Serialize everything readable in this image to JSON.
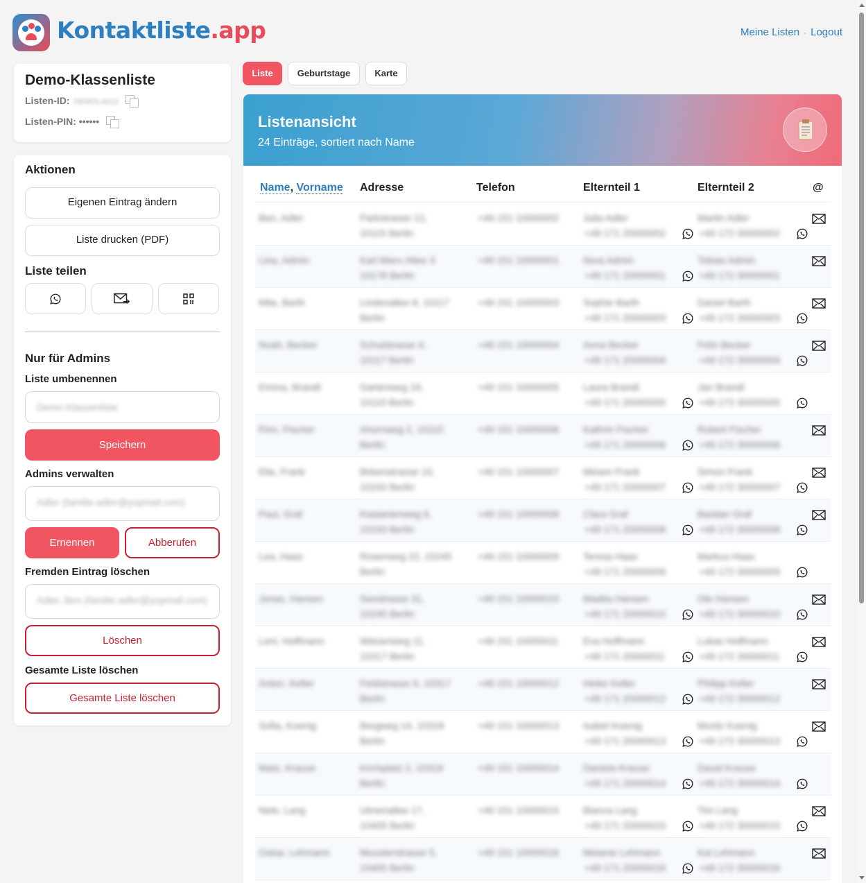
{
  "app": {
    "brand_part1": "Kontaktliste",
    "brand_part2": ".app",
    "nav_my_lists": "Meine Listen",
    "nav_sep": "·",
    "nav_logout": "Logout"
  },
  "list_info": {
    "title": "Demo-Klassenliste",
    "id_label": "Listen-ID:",
    "id_value": "DEMOLA012",
    "pin_label": "Listen-PIN:",
    "pin_value": "••••••"
  },
  "actions": {
    "title": "Aktionen",
    "edit_own": "Eigenen Eintrag ändern",
    "print_pdf": "Liste drucken (PDF)",
    "share_title": "Liste teilen",
    "admin_title": "Nur für Admins",
    "rename_label": "Liste umbenennen",
    "rename_value": "Demo-Klassenliste",
    "save": "Speichern",
    "manage_admins_label": "Admins verwalten",
    "admin_select_value": "Adler (familie.adler@yopmail.com)",
    "appoint": "Ernennen",
    "revoke": "Abberufen",
    "delete_foreign_label": "Fremden Eintrag löschen",
    "delete_select_value": "Adler, Ben (familie.adler@yopmail.com)",
    "delete": "Löschen",
    "delete_all_label": "Gesamte Liste löschen",
    "delete_all": "Gesamte Liste löschen"
  },
  "tabs": [
    {
      "label": "Liste",
      "active": true
    },
    {
      "label": "Geburtstage",
      "active": false
    },
    {
      "label": "Karte",
      "active": false
    }
  ],
  "banner": {
    "title": "Listenansicht",
    "subtitle": "24 Einträge, sortiert nach Name"
  },
  "table": {
    "headers": {
      "name": "Name",
      "comma": ",",
      "vorname": "Vorname",
      "adresse": "Adresse",
      "telefon": "Telefon",
      "eltern1": "Elternteil 1",
      "eltern2": "Elternteil 2",
      "email": "@"
    },
    "rows": [
      {
        "name": "Ben, Adler",
        "addr1": "Parkstrasse 12,",
        "addr2": "10115 Berlin",
        "phone": "+49 151 10000002",
        "p1": "Julia Adler",
        "p1tel": "+49 171 20000002",
        "p2": "Martin Adler",
        "p2tel": "+49 172 30000002",
        "wa1": true,
        "wa2": true,
        "mail": true
      },
      {
        "name": "Lina, Admin",
        "addr1": "Karl-Marx-Allee 3",
        "addr2": "10178 Berlin",
        "phone": "+49 151 10000001",
        "p1": "Nora Admin",
        "p1tel": "+49 171 20000001",
        "p2": "Tobias Admin",
        "p2tel": "+49 172 30000001",
        "wa1": true,
        "wa2": false,
        "mail": true
      },
      {
        "name": "Mila, Barth",
        "addr1": "Lindenallee 8, 10117",
        "addr2": "Berlin",
        "phone": "+49 151 10000003",
        "p1": "Sophie Barth",
        "p1tel": "+49 171 20000003",
        "p2": "Daniel Barth",
        "p2tel": "+49 172 30000003",
        "wa1": true,
        "wa2": true,
        "mail": true
      },
      {
        "name": "Noah, Becker",
        "addr1": "Schulstrasse 4,",
        "addr2": "10117 Berlin",
        "phone": "+49 151 10000004",
        "p1": "Anna Becker",
        "p1tel": "+49 171 20000004",
        "p2": "Felix Becker",
        "p2tel": "+49 172 30000004",
        "wa1": false,
        "wa2": true,
        "mail": true
      },
      {
        "name": "Emma, Brandt",
        "addr1": "Gartenweg 19,",
        "addr2": "10115 Berlin",
        "phone": "+49 151 10000005",
        "p1": "Laura Brandt",
        "p1tel": "+49 171 20000005",
        "p2": "Jan Brandt",
        "p2tel": "+49 172 30000005",
        "wa1": true,
        "wa2": true,
        "mail": false
      },
      {
        "name": "Finn, Fischer",
        "addr1": "Ahornweg 2, 10115",
        "addr2": "Berlin",
        "phone": "+49 151 10000006",
        "p1": "Kathrin Fischer",
        "p1tel": "+49 171 20000006",
        "p2": "Robert Fischer",
        "p2tel": "+49 172 30000006",
        "wa1": true,
        "wa2": false,
        "mail": true
      },
      {
        "name": "Ella, Frank",
        "addr1": "Birkenstrasse 15,",
        "addr2": "10243 Berlin",
        "phone": "+49 151 10000007",
        "p1": "Miriam Frank",
        "p1tel": "+49 171 20000007",
        "p2": "Simon Frank",
        "p2tel": "+49 172 30000007",
        "wa1": true,
        "wa2": true,
        "mail": true
      },
      {
        "name": "Paul, Graf",
        "addr1": "Kastanienweg 6,",
        "addr2": "10243 Berlin",
        "phone": "+49 151 10000008",
        "p1": "Clara Graf",
        "p1tel": "+49 171 20000008",
        "p2": "Bastian Graf",
        "p2tel": "+49 172 30000008",
        "wa1": true,
        "wa2": true,
        "mail": true
      },
      {
        "name": "Lea, Haas",
        "addr1": "Rosenweg 22, 10245",
        "addr2": "Berlin",
        "phone": "+49 151 10000009",
        "p1": "Teresa Haas",
        "p1tel": "+49 171 20000009",
        "p2": "Markus Haas",
        "p2tel": "+49 172 30000009",
        "wa1": false,
        "wa2": true,
        "mail": false
      },
      {
        "name": "Jonas, Hansen",
        "addr1": "Seestrasse 31,",
        "addr2": "10245 Berlin",
        "phone": "+49 151 10000010",
        "p1": "Madita Hansen",
        "p1tel": "+49 171 20000010",
        "p2": "Ole Hansen",
        "p2tel": "+49 172 30000010",
        "wa1": true,
        "wa2": true,
        "mail": true
      },
      {
        "name": "Leni, Hoffmann",
        "addr1": "Wiesenweg 11,",
        "addr2": "10317 Berlin",
        "phone": "+49 151 10000011",
        "p1": "Eva Hoffmann",
        "p1tel": "+49 171 20000011",
        "p2": "Lukas Hoffmann",
        "p2tel": "+49 172 30000011",
        "wa1": true,
        "wa2": true,
        "mail": true
      },
      {
        "name": "Anton, Keller",
        "addr1": "Feldstrasse 9, 10317",
        "addr2": "Berlin",
        "phone": "+49 151 10000012",
        "p1": "Heike Keller",
        "p1tel": "+49 171 20000012",
        "p2": "Philipp Keller",
        "p2tel": "+49 172 30000012",
        "wa1": true,
        "wa2": false,
        "mail": true
      },
      {
        "name": "Sofia, Koenig",
        "addr1": "Bergweg 14, 10318",
        "addr2": "Berlin",
        "phone": "+49 151 10000013",
        "p1": "Isabel Koenig",
        "p1tel": "+49 171 20000013",
        "p2": "Moritz Koenig",
        "p2tel": "+49 172 30000013",
        "wa1": true,
        "wa2": true,
        "mail": true
      },
      {
        "name": "Mats, Krause",
        "addr1": "Kirchplatz 2, 10318",
        "addr2": "Berlin",
        "phone": "+49 151 10000014",
        "p1": "Daniela Krause",
        "p1tel": "+49 171 20000014",
        "p2": "David Krause",
        "p2tel": "+49 172 30000014",
        "wa1": true,
        "wa2": true,
        "mail": false
      },
      {
        "name": "Nele, Lang",
        "addr1": "Ulmenallee 17,",
        "addr2": "10405 Berlin",
        "phone": "+49 151 10000015",
        "p1": "Bianca Lang",
        "p1tel": "+49 171 20000015",
        "p2": "Tim Lang",
        "p2tel": "+49 172 30000015",
        "wa1": true,
        "wa2": true,
        "mail": true
      },
      {
        "name": "Oskar, Lehmann",
        "addr1": "Moosterstrasse 5,",
        "addr2": "10405 Berlin",
        "phone": "+49 151 10000016",
        "p1": "Melanie Lehmann",
        "p1tel": "+49 171 20000016",
        "p2": "Kai Lehmann",
        "p2tel": "+49 172 30000016",
        "wa1": true,
        "wa2": false,
        "mail": true
      }
    ]
  }
}
